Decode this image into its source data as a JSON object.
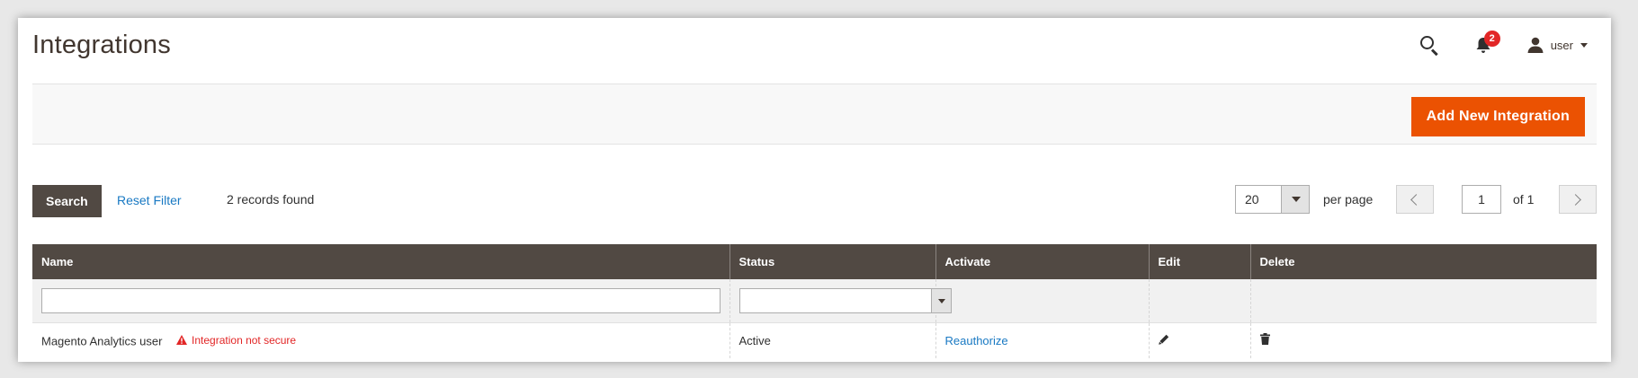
{
  "header": {
    "title": "Integrations",
    "notification_count": "2",
    "user_name": "user",
    "icons": {
      "search": "search-icon",
      "notifications": "bell-icon",
      "user": "user-icon"
    }
  },
  "action_bar": {
    "add_button_label": "Add New Integration"
  },
  "grid_controls": {
    "search_label": "Search",
    "reset_filter_label": "Reset Filter",
    "records_found": "2 records found",
    "per_page_value": "20",
    "per_page_label": "per page",
    "current_page": "1",
    "page_of": "of 1"
  },
  "table": {
    "columns": [
      "Name",
      "Status",
      "Activate",
      "Edit",
      "Delete"
    ],
    "rows": [
      {
        "name": "Magento Analytics user",
        "warning": "Integration not secure",
        "status": "Active",
        "activate": "Reauthorize"
      }
    ]
  },
  "colors": {
    "primary_button": "#eb5202",
    "header_dark": "#514943",
    "link": "#1979c3",
    "alert_red": "#e22626"
  }
}
